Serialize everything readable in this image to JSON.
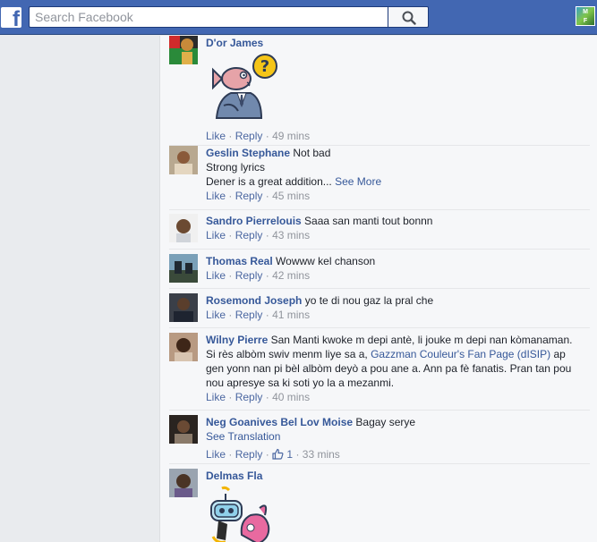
{
  "search": {
    "placeholder": "Search Facebook"
  },
  "profile_badge": {
    "line1": "M",
    "line2": "F",
    "line3": "ATINF"
  },
  "comments": [
    {
      "author": "D'or James",
      "text": "",
      "actions": {
        "like": "Like",
        "reply": "Reply",
        "time": "· 49 mins"
      }
    },
    {
      "author": "Geslin Stephane",
      "text": "Not bad",
      "line2": "Strong lyrics",
      "line3": "Dener is a great addition...",
      "see_more": "See More",
      "actions": {
        "like": "Like",
        "reply": "Reply",
        "time": "· 45 mins"
      }
    },
    {
      "author": "Sandro Pierrelouis",
      "text": "Saaa san manti tout bonnn",
      "actions": {
        "like": "Like",
        "reply": "Reply",
        "time": "· 43 mins"
      }
    },
    {
      "author": "Thomas Real",
      "text": "Wowww kel chanson",
      "actions": {
        "like": "Like",
        "reply": "Reply",
        "time": "· 42 mins"
      }
    },
    {
      "author": "Rosemond Joseph",
      "text": "yo te di nou gaz la pral che",
      "actions": {
        "like": "Like",
        "reply": "Reply",
        "time": "· 41 mins"
      }
    },
    {
      "author": "Wilny Pierre",
      "text_a": "San Manti kwoke m depi antè, li jouke m depi nan kòmanaman.",
      "text_b": "Si rès albòm swiv menm liye sa a,",
      "mention": "Gazzman Couleur's Fan Page (dISIP)",
      "text_c": "ap",
      "text_d": "gen yonn nan pi bèl albòm deyò a pou ane a. Ann pa fè fanatis. Pran tan pou",
      "text_e": "nou apresye sa ki soti yo la a mezanmi.",
      "actions": {
        "like": "Like",
        "reply": "Reply",
        "time": "· 40 mins"
      }
    },
    {
      "author": "Neg Goanives Bel Lov Moise",
      "text": "Bagay serye",
      "see_translation": "See Translation",
      "actions": {
        "like": "Like",
        "reply": "Reply",
        "likes_count": "1",
        "time": "· 33 mins"
      }
    },
    {
      "author": "Delmas Fla",
      "text": ""
    }
  ]
}
